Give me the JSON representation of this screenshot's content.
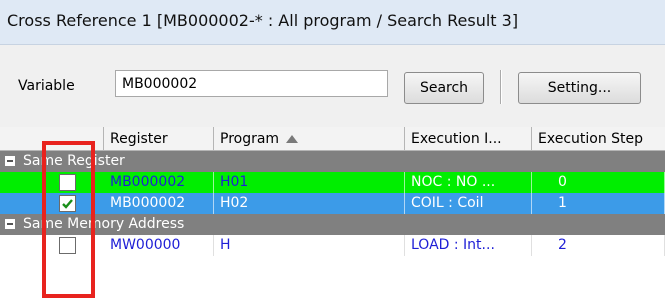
{
  "window": {
    "title": "Cross Reference 1 [MB000002-* : All program  / Search Result 3]"
  },
  "toolbar": {
    "variable_label": "Variable",
    "variable_value": "MB000002",
    "search_label": "Search",
    "setting_label": "Setting..."
  },
  "grid": {
    "columns": [
      "Register",
      "Program",
      "Execution I...",
      "Execution Step"
    ],
    "sort_icon": "sort-ascending-icon",
    "groups": [
      {
        "label": "Same Register",
        "rows": [
          {
            "checked": false,
            "register": "MB000002",
            "program": "H01",
            "instruction": "NOC : NO ...",
            "step": "0"
          },
          {
            "checked": true,
            "register": "MB000002",
            "program": "H02",
            "instruction": "COIL : Coil",
            "step": "1"
          }
        ]
      },
      {
        "label": "Same Memory Address",
        "rows": [
          {
            "checked": false,
            "register": "MW00000",
            "program": "H",
            "instruction": "LOAD : Int...",
            "step": "2"
          }
        ]
      }
    ]
  },
  "colors": {
    "row_green": "#00ee00",
    "row_selected": "#3c9be8",
    "group_header": "#808080",
    "highlight_box": "#e8231e",
    "link_text": "#1f1fd6"
  }
}
